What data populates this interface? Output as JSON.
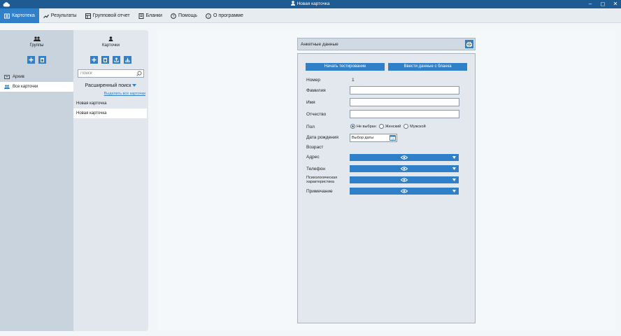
{
  "window": {
    "title": "Новая карточка"
  },
  "menu": {
    "items": [
      {
        "label": "Картотека",
        "icon": "card-file-icon",
        "active": true
      },
      {
        "label": "Результаты",
        "icon": "chart-line-icon",
        "active": false
      },
      {
        "label": "Групповой отчет",
        "icon": "group-report-icon",
        "active": false
      },
      {
        "label": "Бланки",
        "icon": "forms-icon",
        "active": false
      },
      {
        "label": "Помощь",
        "icon": "help-icon",
        "active": false
      },
      {
        "label": "О программе",
        "icon": "info-icon",
        "active": false
      }
    ]
  },
  "groups": {
    "title": "Группы",
    "items": [
      {
        "label": "Архив",
        "icon": "archive-icon",
        "selected": false
      },
      {
        "label": "Все карточки",
        "icon": "people-icon",
        "selected": true
      }
    ]
  },
  "cards": {
    "title": "Карточки",
    "search_placeholder": "Поиск",
    "advanced_search": "Расширенный поиск",
    "select_all": "Выделить все карточки",
    "items": [
      {
        "label": "Новая карточка",
        "selected": false
      },
      {
        "label": "Новая карточка",
        "selected": true
      }
    ]
  },
  "form": {
    "header": "Анкетные данные",
    "start_test": "Начать тестирование",
    "enter_from_form": "Ввести данные с бланка",
    "number_label": "Номер",
    "number_value": "1",
    "surname_label": "Фамилия",
    "name_label": "Имя",
    "patronymic_label": "Отчество",
    "gender_label": "Пол",
    "gender_options": [
      "Не выбран",
      "Женский",
      "Мужской"
    ],
    "birthdate_label": "Дата рождения",
    "birthdate_placeholder": "Выбор даты",
    "age_label": "Возраст",
    "address_label": "Адрес",
    "phone_label": "Телефон",
    "psych_label": "Психологическая характеристика",
    "note_label": "Примечание"
  },
  "colors": {
    "accent": "#2f80c8",
    "titlebar": "#1e5b92"
  }
}
